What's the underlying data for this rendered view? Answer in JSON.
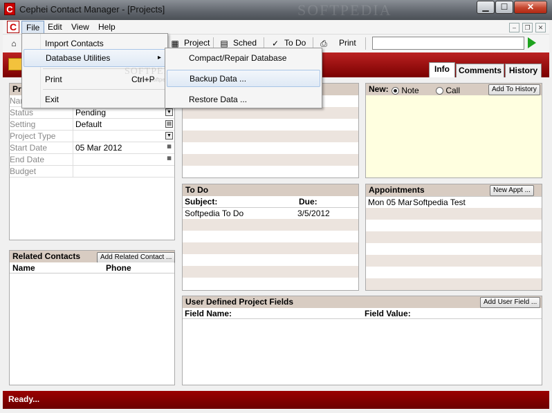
{
  "window": {
    "title": "Cephei Contact Manager - [Projects]",
    "app_icon": "C",
    "watermark": "SOFTPEDIA",
    "caption_buttons": {
      "minimize": "▁",
      "maximize": "☐",
      "close": "✕"
    }
  },
  "menubar": {
    "items": [
      "File",
      "Edit",
      "View",
      "Help"
    ],
    "mdi_buttons": [
      "‒",
      "❐",
      "✕"
    ]
  },
  "file_menu": {
    "items": [
      {
        "label": "Import Contacts",
        "shortcut": "",
        "arrow": ""
      },
      {
        "label": "Database Utilities",
        "shortcut": "",
        "arrow": "▸"
      },
      {
        "label": "Print",
        "shortcut": "Ctrl+P",
        "arrow": ""
      },
      {
        "label": "Exit",
        "shortcut": "",
        "arrow": ""
      }
    ],
    "watermark": "SOFTPEDIA",
    "watermark_url": "www.softpedia.com"
  },
  "submenu": {
    "items": [
      "Compact/Repair Database",
      "Backup Data ...",
      "Restore Data ..."
    ]
  },
  "toolbar": {
    "project_label": "Project",
    "sched_label": "Sched",
    "todo_label": "To Do",
    "print_label": "Print",
    "search_value": ""
  },
  "tabs": [
    "Info",
    "Comments",
    "History"
  ],
  "project_panel": {
    "header": "Pr",
    "rows": [
      {
        "label": "Nar",
        "value": "",
        "btn": ""
      },
      {
        "label": "Status",
        "value": "Pending",
        "btn": "▼"
      },
      {
        "label": "Setting",
        "value": "Default",
        "btn": "▤"
      },
      {
        "label": "Project Type",
        "value": "",
        "btn": "▼"
      },
      {
        "label": "Start Date",
        "value": "05 Mar 2012",
        "btn": "▦"
      },
      {
        "label": "End Date",
        "value": "",
        "btn": "▦"
      },
      {
        "label": "Budget",
        "value": "",
        "btn": ""
      }
    ]
  },
  "related_contacts": {
    "header": "Related Contacts",
    "add_button": "Add Related Contact ...",
    "columns": [
      "Name",
      "Phone"
    ]
  },
  "todo": {
    "header": "To Do",
    "columns": [
      "Subject:",
      "Due:"
    ],
    "rows": [
      {
        "subject": "Softpedia To Do",
        "due": "3/5/2012"
      }
    ]
  },
  "new_entry": {
    "label": "New:",
    "note_label": "Note",
    "call_label": "Call",
    "add_button": "Add To History"
  },
  "appointments": {
    "header": "Appointments",
    "add_button": "New Appt ...",
    "rows": [
      {
        "date": "Mon 05 Mar",
        "subject": "Softpedia Test"
      }
    ]
  },
  "user_fields": {
    "header": "User Defined Project Fields",
    "add_button": "Add User Field ...",
    "columns": [
      "Field Name:",
      "Field Value:"
    ]
  },
  "status": {
    "text": "Ready..."
  },
  "colors": {
    "brand_red": "#8b0000",
    "accent_green": "#1fa31f",
    "panel_header": "#d8ccc2"
  }
}
